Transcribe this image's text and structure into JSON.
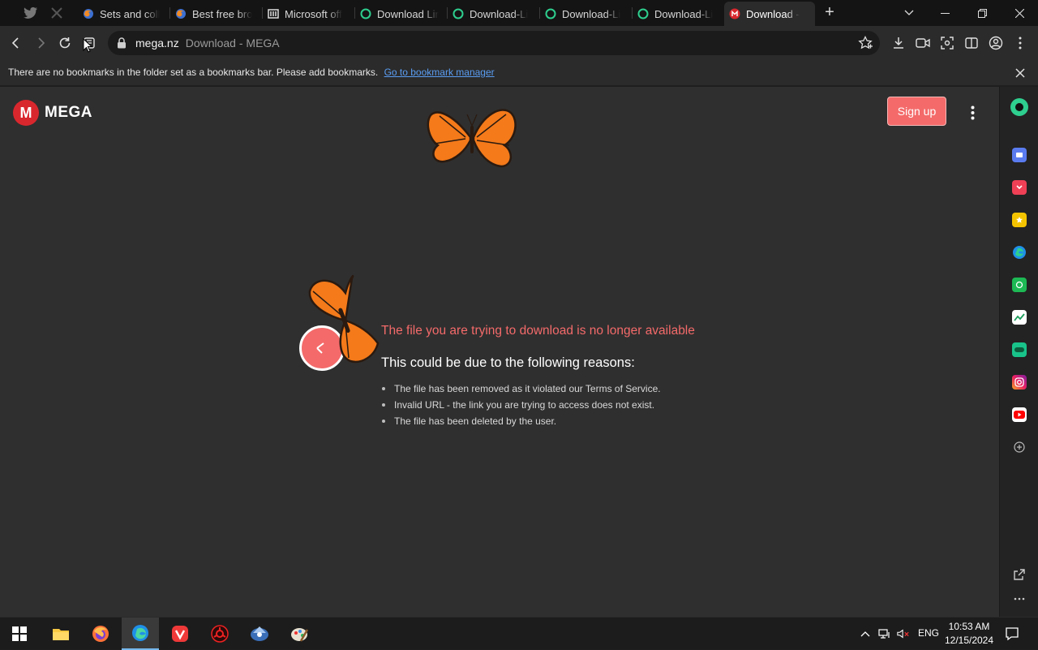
{
  "tabs": [
    {
      "label": "Sets and coll",
      "icon": "globe-firefox-icon"
    },
    {
      "label": "Best free bro",
      "icon": "globe-firefox-icon"
    },
    {
      "label": "Microsoft off",
      "icon": "office-icon"
    },
    {
      "label": "Download Lin",
      "icon": "green-circle-icon"
    },
    {
      "label": "Download-Li",
      "icon": "green-circle-icon"
    },
    {
      "label": "Download-Li",
      "icon": "green-circle-icon"
    },
    {
      "label": "Download-Li",
      "icon": "green-circle-icon"
    },
    {
      "label": "Download - ",
      "icon": "mega-icon",
      "active": true
    }
  ],
  "address": {
    "host": "mega.nz",
    "title": "Download - MEGA"
  },
  "bookmarks_bar": {
    "message": "There are no bookmarks in the folder set as a bookmarks bar. Please add bookmarks.",
    "link": "Go to bookmark manager"
  },
  "page": {
    "logo_mark": "M",
    "logo_text": "MEGA",
    "signup_label": "Sign up",
    "error_title": "The file you are trying to download is no longer available",
    "error_subtitle": "This could be due to the following reasons:",
    "reasons": [
      "The file has been removed as it violated our Terms of Service.",
      "Invalid URL - the link you are trying to access does not exist.",
      "The file has been deleted by the user."
    ]
  },
  "taskbar": {
    "language": "ENG",
    "time": "10:53 AM",
    "date": "12/15/2024"
  },
  "colors": {
    "accent_red": "#f46a6a",
    "mega_red": "#d9272e",
    "link_blue": "#5a9df2"
  }
}
